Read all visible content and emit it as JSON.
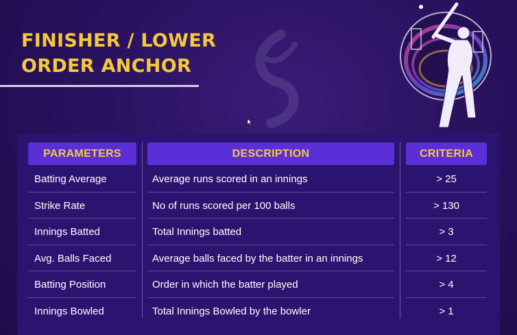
{
  "title": {
    "line1": "FINISHER / LOWER",
    "line2": "ORDER ANCHOR"
  },
  "table": {
    "headers": {
      "parameters": "PARAMETERS",
      "description": "DESCRIPTION",
      "criteria": "CRITERIA"
    },
    "rows": [
      {
        "parameter": "Batting Average",
        "description": "Average runs scored in an innings",
        "criteria": "> 25"
      },
      {
        "parameter": "Strike Rate",
        "description": "No of runs scored per 100 balls",
        "criteria": "> 130"
      },
      {
        "parameter": "Innings Batted",
        "description": "Total Innings batted",
        "criteria": "> 3"
      },
      {
        "parameter": "Avg. Balls Faced",
        "description": "Average balls faced by the batter in an innings",
        "criteria": "> 12"
      },
      {
        "parameter": "Batting Position",
        "description": "Order in which the batter played",
        "criteria": "> 4"
      },
      {
        "parameter": "Innings Bowled",
        "description": "Total Innings Bowled by the bowler",
        "criteria": "> 1"
      }
    ]
  },
  "colors": {
    "accent_yellow": "#f6c93a",
    "header_purple": "#5a2fd8",
    "background": "#2a1260"
  },
  "icons": {
    "emblem": "cricket-batter-emblem-icon",
    "cursor": "mouse-cursor-icon"
  }
}
